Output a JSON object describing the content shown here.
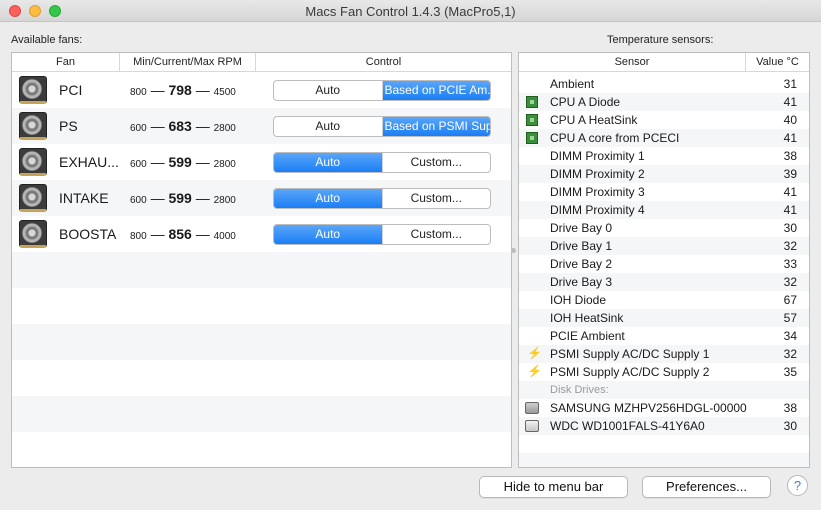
{
  "window": {
    "title": "Macs Fan Control 1.4.3 (MacPro5,1)"
  },
  "fans_panel": {
    "label": "Available fans:",
    "columns": {
      "fan": "Fan",
      "rpm": "Min/Current/Max RPM",
      "control": "Control"
    },
    "rows": [
      {
        "name": "PCI",
        "min": "800",
        "sep1": "—",
        "current": "798",
        "sep2": "—",
        "max": "4500",
        "auto": "Auto",
        "other": "Based on PCIE Am...",
        "selected": "other"
      },
      {
        "name": "PS",
        "min": "600",
        "sep1": "—",
        "current": "683",
        "sep2": "—",
        "max": "2800",
        "auto": "Auto",
        "other": "Based on PSMI Sup...",
        "selected": "other"
      },
      {
        "name": "EXHAU...",
        "min": "600",
        "sep1": "—",
        "current": "599",
        "sep2": "—",
        "max": "2800",
        "auto": "Auto",
        "other": "Custom...",
        "selected": "auto"
      },
      {
        "name": "INTAKE",
        "min": "600",
        "sep1": "—",
        "current": "599",
        "sep2": "—",
        "max": "2800",
        "auto": "Auto",
        "other": "Custom...",
        "selected": "auto"
      },
      {
        "name": "BOOSTA",
        "min": "800",
        "sep1": "—",
        "current": "856",
        "sep2": "—",
        "max": "4000",
        "auto": "Auto",
        "other": "Custom...",
        "selected": "auto"
      }
    ]
  },
  "sensors_panel": {
    "label": "Temperature sensors:",
    "columns": {
      "sensor": "Sensor",
      "value": "Value °C"
    },
    "rows": [
      {
        "name": "Ambient",
        "value": "31",
        "icon": "none"
      },
      {
        "name": "CPU A Diode",
        "value": "41",
        "icon": "chip-icon"
      },
      {
        "name": "CPU A HeatSink",
        "value": "40",
        "icon": "chip-icon"
      },
      {
        "name": "CPU A core from PCECI",
        "value": "41",
        "icon": "chip-icon"
      },
      {
        "name": "DIMM Proximity 1",
        "value": "38",
        "icon": "none"
      },
      {
        "name": "DIMM Proximity 2",
        "value": "39",
        "icon": "none"
      },
      {
        "name": "DIMM Proximity 3",
        "value": "41",
        "icon": "none"
      },
      {
        "name": "DIMM Proximity 4",
        "value": "41",
        "icon": "none"
      },
      {
        "name": "Drive Bay 0",
        "value": "30",
        "icon": "none"
      },
      {
        "name": "Drive Bay 1",
        "value": "32",
        "icon": "none"
      },
      {
        "name": "Drive Bay 2",
        "value": "33",
        "icon": "none"
      },
      {
        "name": "Drive Bay 3",
        "value": "32",
        "icon": "none"
      },
      {
        "name": "IOH Diode",
        "value": "67",
        "icon": "none"
      },
      {
        "name": "IOH HeatSink",
        "value": "57",
        "icon": "none"
      },
      {
        "name": "PCIE Ambient",
        "value": "34",
        "icon": "none"
      },
      {
        "name": "PSMI Supply AC/DC Supply 1",
        "value": "32",
        "icon": "lightning-icon"
      },
      {
        "name": "PSMI Supply AC/DC Supply 2",
        "value": "35",
        "icon": "lightning-icon"
      }
    ],
    "disk_section_label": "Disk Drives:",
    "disks": [
      {
        "name": "SAMSUNG MZHPV256HDGL-00000",
        "value": "38",
        "icon": "ssd-icon"
      },
      {
        "name": "WDC WD1001FALS-41Y6A0",
        "value": "30",
        "icon": "hdd-icon"
      }
    ]
  },
  "footer": {
    "hide_button": "Hide to menu bar",
    "preferences_button": "Preferences...",
    "help_button": "?"
  },
  "colors": {
    "accent": "#1a7ef5",
    "row_stripe": "#f5f6f8"
  }
}
